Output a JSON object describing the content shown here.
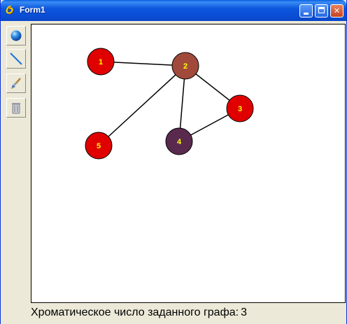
{
  "window": {
    "title": "Form1",
    "app_icon_glyph": "Ỽ",
    "minimize_glyph": "",
    "close_glyph": "✕"
  },
  "toolbar": {
    "tools": [
      {
        "name": "add-vertex-tool",
        "icon": "blue-sphere-icon"
      },
      {
        "name": "add-edge-tool",
        "icon": "line-icon"
      },
      {
        "name": "color-brush-tool",
        "icon": "brush-icon"
      },
      {
        "name": "delete-tool",
        "icon": "trash-icon"
      }
    ]
  },
  "graph": {
    "vertices": [
      {
        "label": "1",
        "color": "#e00000"
      },
      {
        "label": "2",
        "color": "#a14a3c"
      },
      {
        "label": "3",
        "color": "#e00000"
      },
      {
        "label": "4",
        "color": "#5a2a4e"
      },
      {
        "label": "5",
        "color": "#e00000"
      }
    ],
    "edges": [
      [
        "1",
        "2"
      ],
      [
        "2",
        "3"
      ],
      [
        "2",
        "4"
      ],
      [
        "2",
        "5"
      ],
      [
        "3",
        "4"
      ]
    ],
    "label_color": "#ffff00",
    "edge_color": "#000000"
  },
  "status": {
    "label": "Хроматическое число заданного графа:",
    "value": "3"
  }
}
